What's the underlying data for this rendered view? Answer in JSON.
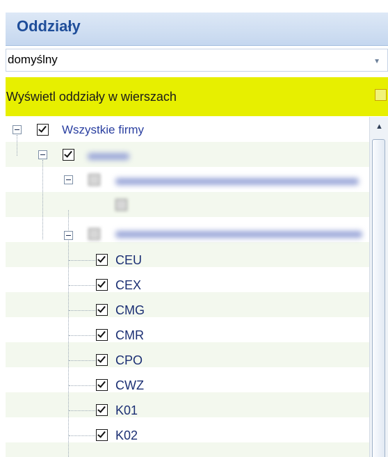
{
  "panel": {
    "title": "Oddziały"
  },
  "profile_select": {
    "value": "domyślny"
  },
  "option": {
    "label": "Wyświetl oddziały w wierszach",
    "checked": false
  },
  "tree": {
    "root": {
      "label": "Wszystkie firmy",
      "checked": true
    },
    "branches": [
      {
        "label": "CEU",
        "checked": true
      },
      {
        "label": "CEX",
        "checked": true
      },
      {
        "label": "CMG",
        "checked": true
      },
      {
        "label": "CMR",
        "checked": true
      },
      {
        "label": "CPO",
        "checked": true
      },
      {
        "label": "CWZ",
        "checked": true
      },
      {
        "label": "K01",
        "checked": true
      },
      {
        "label": "K02",
        "checked": true
      }
    ]
  },
  "colors": {
    "header_title": "#1f4e9a",
    "highlight": "#e7ef00",
    "label": "#1b2f73"
  },
  "icons": [
    "collapse-icon",
    "checkbox-checked-icon",
    "chevron-down-icon",
    "scroll-up-icon"
  ]
}
